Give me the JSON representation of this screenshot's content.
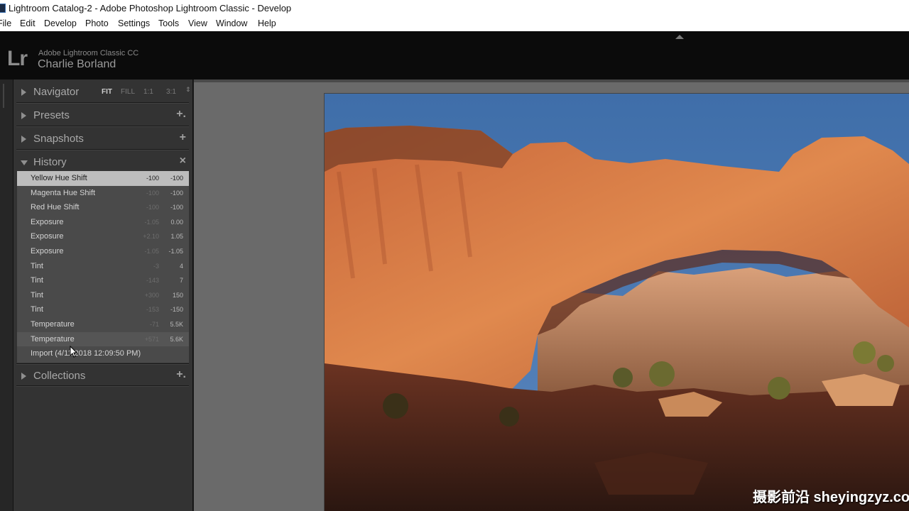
{
  "window": {
    "title": "Lightroom Catalog-2 - Adobe Photoshop Lightroom Classic - Develop"
  },
  "menu": [
    "File",
    "Edit",
    "Develop",
    "Photo",
    "Settings",
    "Tools",
    "View",
    "Window",
    "Help"
  ],
  "identity": {
    "logo": "Lr",
    "product": "Adobe Lightroom Classic CC",
    "user": "Charlie Borland"
  },
  "panels": {
    "navigator": {
      "label": "Navigator",
      "zoom": [
        "FIT",
        "FILL",
        "1:1",
        "3:1"
      ],
      "zoom_arrow": "⇕"
    },
    "presets": {
      "label": "Presets",
      "action": "+."
    },
    "snapshots": {
      "label": "Snapshots",
      "action": "+"
    },
    "history": {
      "label": "History",
      "action": "×"
    },
    "collections": {
      "label": "Collections",
      "action": "+."
    }
  },
  "history_items": [
    {
      "name": "Yellow Hue Shift",
      "before": "-100",
      "after": "-100",
      "selected": true
    },
    {
      "name": "Magenta Hue Shift",
      "before": "-100",
      "after": "-100"
    },
    {
      "name": "Red Hue Shift",
      "before": "-100",
      "after": "-100"
    },
    {
      "name": "Exposure",
      "before": "-1.05",
      "after": "0.00"
    },
    {
      "name": "Exposure",
      "before": "+2.10",
      "after": "1.05"
    },
    {
      "name": "Exposure",
      "before": "-1.05",
      "after": "-1.05"
    },
    {
      "name": "Tint",
      "before": "-3",
      "after": "4"
    },
    {
      "name": "Tint",
      "before": "-143",
      "after": "7"
    },
    {
      "name": "Tint",
      "before": "+300",
      "after": "150"
    },
    {
      "name": "Tint",
      "before": "-153",
      "after": "-150"
    },
    {
      "name": "Temperature",
      "before": "-71",
      "after": "5.5K"
    },
    {
      "name": "Temperature",
      "before": "+571",
      "after": "5.6K"
    },
    {
      "name": "Import (4/11/2018 12:09:50 PM)",
      "before": "",
      "after": ""
    }
  ],
  "watermark": "摄影前沿 sheyingzyz.com",
  "colors": {
    "selected_row": "#bdbdbd",
    "panel_bg": "#333333",
    "center_bg": "#6a6a6a",
    "sky": "#4f7ab0"
  }
}
